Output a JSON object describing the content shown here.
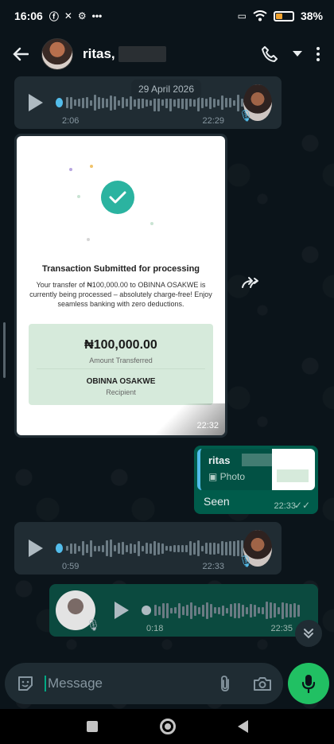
{
  "status_bar": {
    "time": "16:06",
    "battery": "38%",
    "battery_level": 0.38
  },
  "header": {
    "contact_name": "ritas,",
    "icons": [
      "back-arrow-icon",
      "avatar",
      "call-icon",
      "dropdown-icon",
      "more-icon"
    ]
  },
  "date_chip": "29 April 2026",
  "messages": {
    "voice1": {
      "duration": "2:06",
      "time": "22:29"
    },
    "receipt": {
      "title": "Transaction Submitted for processing",
      "description": "Your transfer of ₦100,000.00 to OBINNA OSAKWE is currently being processed – absolutely charge-free! Enjoy seamless banking with zero deductions.",
      "amount": "₦100,000.00",
      "amount_label": "Amount Transferred",
      "recipient_name": "OBINNA OSAKWE",
      "recipient_label": "Recipient",
      "time": "22:32"
    },
    "reply": {
      "quoted_name": "ritas",
      "quoted_type": "Photo",
      "text": "Seen",
      "time": "22:33"
    },
    "voice2": {
      "duration": "0:59",
      "time": "22:33"
    },
    "voice3": {
      "duration": "0:18",
      "time": "22:35"
    }
  },
  "input": {
    "placeholder": "Message"
  },
  "colors": {
    "background": "#0b141a",
    "incoming_bubble": "#202c33",
    "outgoing_bubble": "#005c4b",
    "accent_green": "#21c063",
    "accent_blue": "#53bdeb"
  }
}
